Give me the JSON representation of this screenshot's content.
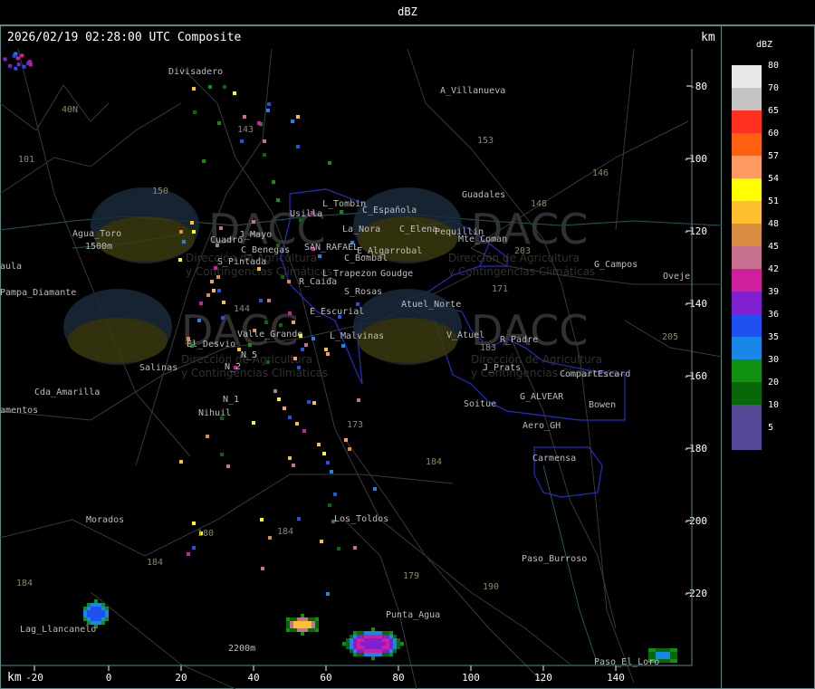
{
  "window": {
    "title": "dBZ"
  },
  "header": {
    "timestamp": "2026/02/19 02:28:00 UTC Composite",
    "unit_right": "km",
    "unit_bottom": "km"
  },
  "axes": {
    "x_ticks": [
      "-20",
      "0",
      "20",
      "40",
      "60",
      "80",
      "100",
      "120",
      "140"
    ],
    "y_ticks": [
      "-80",
      "-100",
      "-120",
      "-140",
      "-160",
      "-180",
      "-200",
      "-220"
    ]
  },
  "legend": {
    "title": "dBZ",
    "entries": [
      {
        "label": "80",
        "color": "#e8e8e8"
      },
      {
        "label": "70",
        "color": "#c4c4c4"
      },
      {
        "label": "65",
        "color": "#ff3020"
      },
      {
        "label": "60",
        "color": "#ff6010"
      },
      {
        "label": "57",
        "color": "#ff9a60"
      },
      {
        "label": "54",
        "color": "#ffff00"
      },
      {
        "label": "51",
        "color": "#ffc030"
      },
      {
        "label": "48",
        "color": "#d98c40"
      },
      {
        "label": "45",
        "color": "#c87090"
      },
      {
        "label": "42",
        "color": "#d020a0"
      },
      {
        "label": "39",
        "color": "#8020d0"
      },
      {
        "label": "36",
        "color": "#2050f0"
      },
      {
        "label": "35",
        "color": "#1888e8"
      },
      {
        "label": "30",
        "color": "#109010"
      },
      {
        "label": "20",
        "color": "#086808"
      },
      {
        "label": "10",
        "color": "#584898"
      },
      {
        "label": "5",
        "color": "#584898"
      }
    ]
  },
  "watermark": {
    "brand": "DACC",
    "line1": "Dirección de Agricultura",
    "line2": "y Contingencias Climáticas"
  },
  "places": [
    {
      "name": "Divisadero"
    },
    {
      "name": "A_Villanueva"
    },
    {
      "name": "Guadales"
    },
    {
      "name": "Usilla"
    },
    {
      "name": "L_Tombin"
    },
    {
      "name": "C_Española"
    },
    {
      "name": "La_Nora"
    },
    {
      "name": "C_Elena"
    },
    {
      "name": "Pequillin"
    },
    {
      "name": "Agua_Toro"
    },
    {
      "name": "J_Mayo"
    },
    {
      "name": "Cuadro"
    },
    {
      "name": "C_Benegas"
    },
    {
      "name": "SAN_RAFAEL"
    },
    {
      "name": "E_Algarrobal"
    },
    {
      "name": "Mte_Coman"
    },
    {
      "name": "Goudge"
    },
    {
      "name": "G_Campos"
    },
    {
      "name": "S_Pintada"
    },
    {
      "name": "C_Bombal"
    },
    {
      "name": "L_Trapezon"
    },
    {
      "name": "R_Caida"
    },
    {
      "name": "S_Rosas"
    },
    {
      "name": "Atuel_Norte"
    },
    {
      "name": "E_Escurial"
    },
    {
      "name": "Valle_Grande"
    },
    {
      "name": "L_Malvinas"
    },
    {
      "name": "V_Atuel"
    },
    {
      "name": "R_Padre"
    },
    {
      "name": "El_Desvio"
    },
    {
      "name": "N_5"
    },
    {
      "name": "Salinas"
    },
    {
      "name": "N_2"
    },
    {
      "name": "J_Prats"
    },
    {
      "name": "CompartEscard"
    },
    {
      "name": "Cda_Amarilla"
    },
    {
      "name": "N_1"
    },
    {
      "name": "G_ALVEAR"
    },
    {
      "name": "Nihuil"
    },
    {
      "name": "Soitue"
    },
    {
      "name": "Bowen"
    },
    {
      "name": "Aero_GH"
    },
    {
      "name": "Carmensa"
    },
    {
      "name": "Morados"
    },
    {
      "name": "Los_Toldos"
    },
    {
      "name": "Paso_Burroso"
    },
    {
      "name": "Punta_Agua"
    },
    {
      "name": "Lag_Llancanelo"
    },
    {
      "name": "Paso_El_Loro"
    },
    {
      "name": "Pampa_Diamante"
    },
    {
      "name": "aula"
    },
    {
      "name": "amentos"
    },
    {
      "name": "Oveje"
    },
    {
      "name": "1500m"
    },
    {
      "name": "2200m"
    }
  ],
  "routes": [
    {
      "name": "101"
    },
    {
      "name": "40N"
    },
    {
      "name": "143"
    },
    {
      "name": "153"
    },
    {
      "name": "146"
    },
    {
      "name": "148"
    },
    {
      "name": "150"
    },
    {
      "name": "203"
    },
    {
      "name": "144"
    },
    {
      "name": "171"
    },
    {
      "name": "173"
    },
    {
      "name": "184"
    },
    {
      "name": "180"
    },
    {
      "name": "179"
    },
    {
      "name": "190"
    },
    {
      "name": "205"
    },
    {
      "name": "183"
    }
  ]
}
